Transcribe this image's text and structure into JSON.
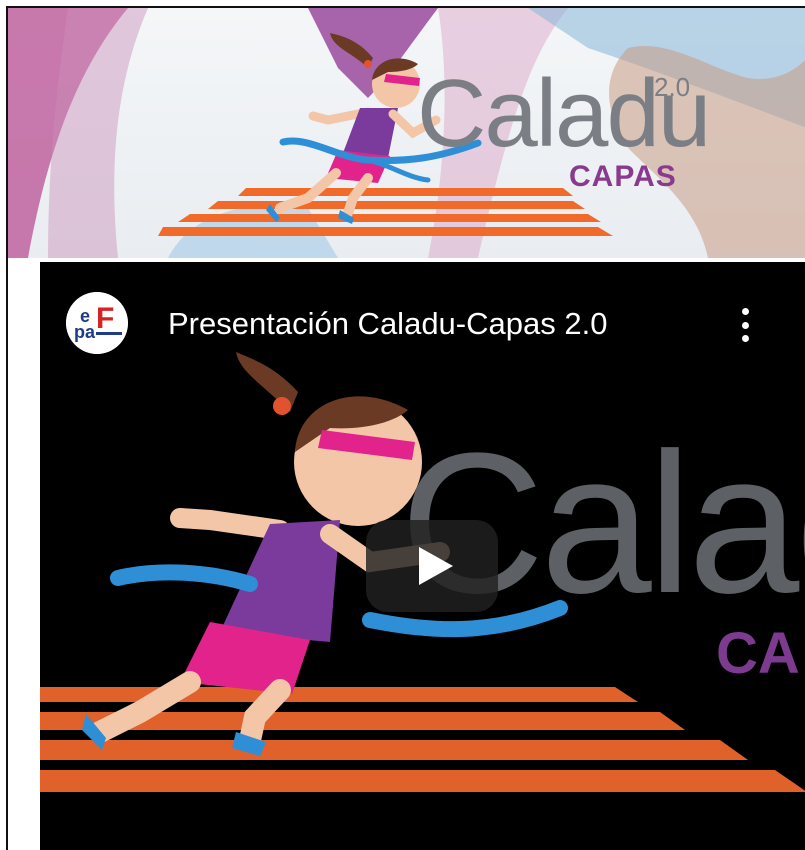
{
  "header": {
    "brand_word": "Caladu",
    "brand_version": "2.0",
    "brand_sub": "CAPAS"
  },
  "video": {
    "title": "Presentación Caladu-Capas 2.0",
    "channel_avatar_text": "epaF",
    "thumbnail_word": "Calad",
    "thumbnail_sub": "CA",
    "play_icon": "play-icon",
    "more_icon": "more-vertical-icon"
  },
  "colors": {
    "brand_gray": "#7b7f85",
    "brand_purple": "#8a3a8e",
    "track_orange": "#f26a2a",
    "ribbon_blue": "#2f8fd6",
    "shirt_purple": "#7a3b9c",
    "shorts_pink": "#e2238c",
    "video_bg": "#000000"
  }
}
